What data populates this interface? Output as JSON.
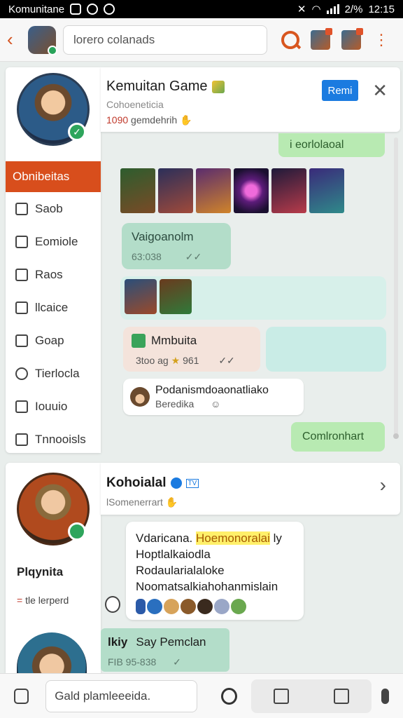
{
  "status_bar": {
    "app_name": "Komunitane",
    "battery": "2/%",
    "time": "12:15"
  },
  "topbar": {
    "search_placeholder": "lorero colanads"
  },
  "sidebar": {
    "active_item": "Obnibeitas",
    "items": [
      {
        "label": "Saob",
        "icon": "puzzle-icon"
      },
      {
        "label": "Eomiole",
        "icon": "grid-icon"
      },
      {
        "label": "Raos",
        "icon": "image-icon"
      },
      {
        "label": "llcaice",
        "icon": "bookmark-icon"
      },
      {
        "label": "Goap",
        "icon": "check-box-icon"
      },
      {
        "label": "Tierlocla",
        "icon": "compass-icon"
      },
      {
        "label": "Iouuio",
        "icon": "tag-icon"
      },
      {
        "label": "Tnnooisls",
        "icon": "lock-icon"
      }
    ]
  },
  "chat1": {
    "title": "Kemuitan Game",
    "subtitle": "Cohoeneticia",
    "meta_red": "1090",
    "meta_text": "gemdehrih",
    "join_label": "Remi",
    "messages": {
      "green_top": "i eorlolaoal",
      "bubble1_text": "Vaigoanolm",
      "bubble1_time": "63:038",
      "beige_text": "Mmbuita",
      "beige_meta_left": "3too ag",
      "beige_meta_right": "961",
      "white_text": "Podanismdoaonatliako",
      "white_sub": "Beredika",
      "green_bottom": "Comlronhart"
    }
  },
  "panel2": {
    "sidebar_name": "Plqynita",
    "sidebar_sub_red": "=",
    "sidebar_sub": "tle lerperd",
    "title": "Kohoialal",
    "subtitle": "lSomenerrart",
    "card_line1_plain": "Vdaricana.",
    "card_line1_highlight": "Hoemonoralai",
    "card_line1_end": "ly",
    "card_line2": "Hoptlalkaiodla",
    "card_line3": "Rodaularialaloke",
    "card_line4": "Noomatsalkiahohanmislain",
    "last_sender": "lkiy",
    "last_text": "Say Pemclan",
    "last_meta": "FIB  95-838"
  },
  "composer": {
    "placeholder": "Gald plamleeeida."
  },
  "colors": {
    "accent": "#d84e1c",
    "join_blue": "#1b7be0",
    "bubble_green": "#b8eab2",
    "bubble_mint": "#b3ddc9"
  }
}
